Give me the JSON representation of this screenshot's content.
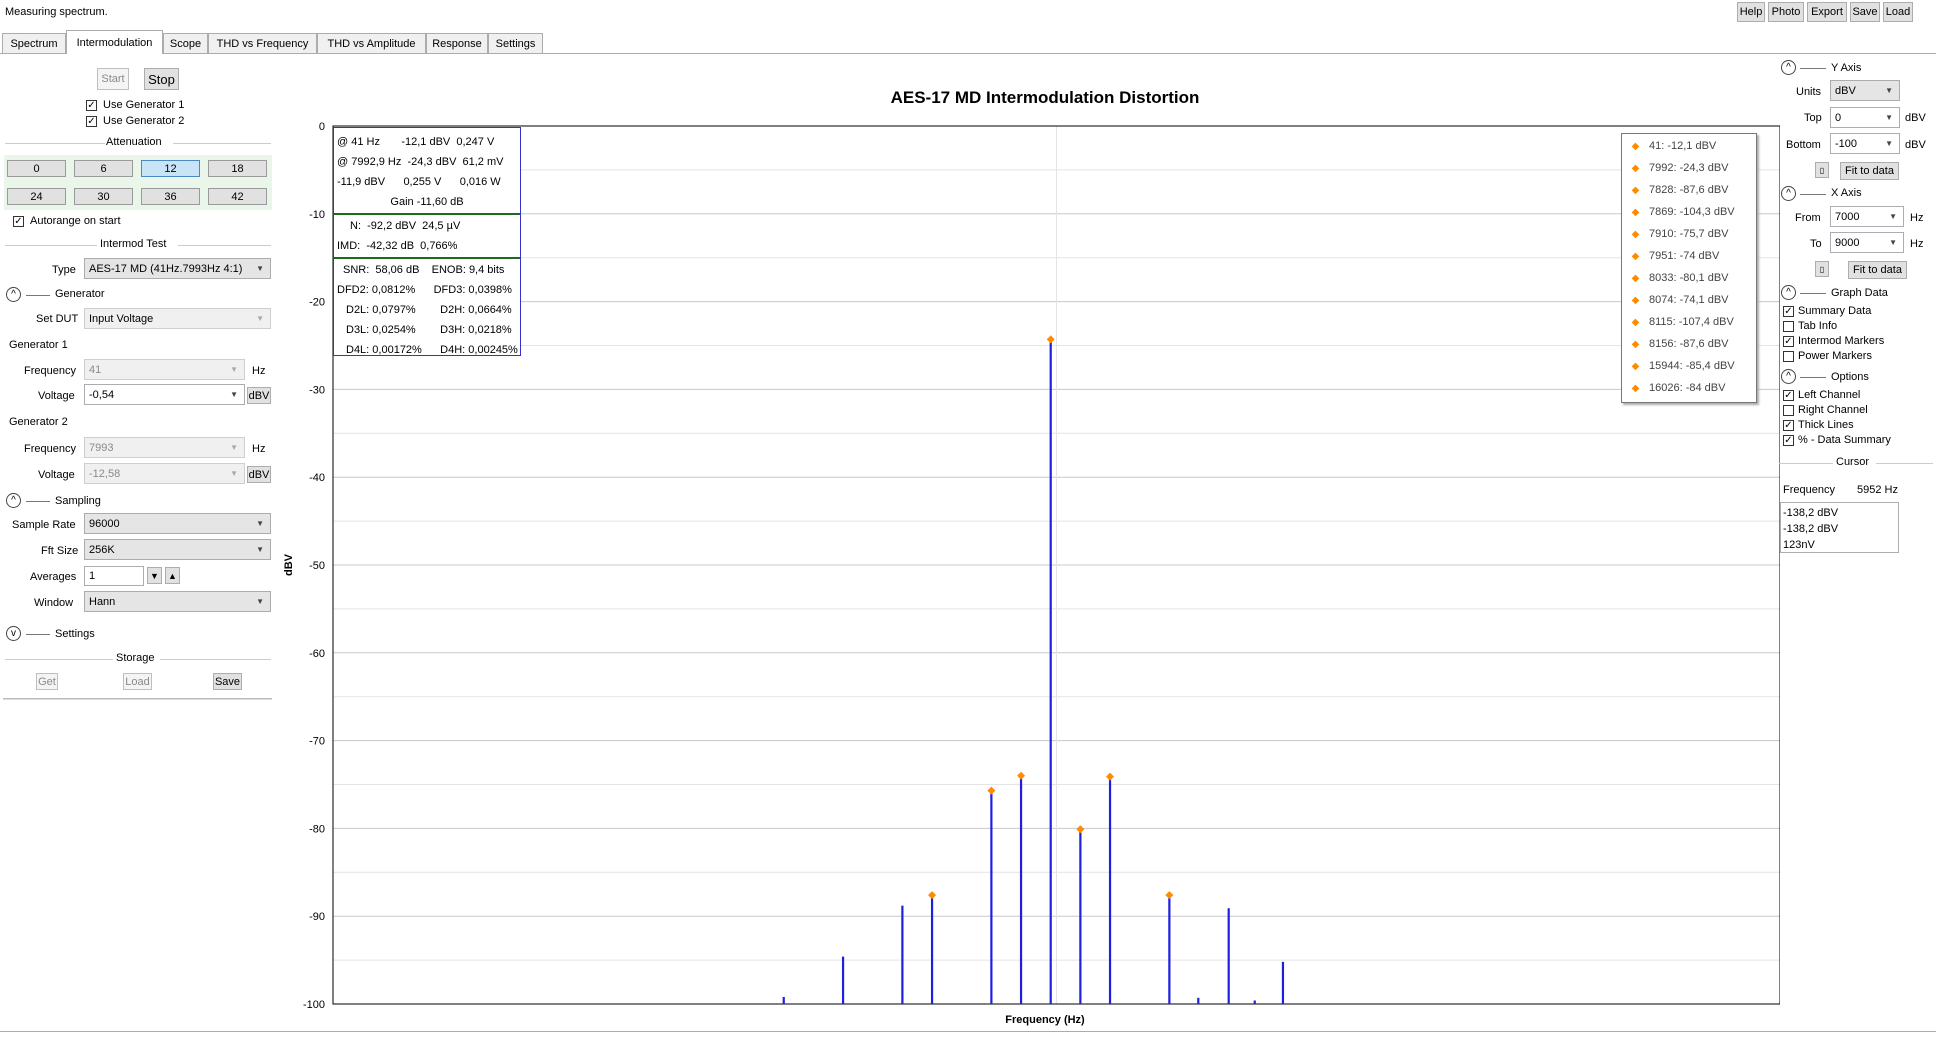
{
  "status": "Measuring spectrum.",
  "top_buttons": [
    "Help",
    "Photo",
    "Export",
    "Save",
    "Load"
  ],
  "tabs": [
    "Spectrum",
    "Intermodulation",
    "Scope",
    "THD vs Frequency",
    "THD vs Amplitude",
    "Response",
    "Settings"
  ],
  "left": {
    "start": "Start",
    "stop": "Stop",
    "use_gen1": "Use Generator 1",
    "use_gen2": "Use Generator 2",
    "attenuation_title": "Attenuation",
    "attenuation": [
      "0",
      "6",
      "12",
      "18",
      "24",
      "30",
      "36",
      "42"
    ],
    "attenuation_selected": "12",
    "autorange": "Autorange on start",
    "intermod_title": "Intermod Test",
    "type_label": "Type",
    "type_value": "AES-17 MD (41Hz.7993Hz 4:1)",
    "generator_title": "Generator",
    "setdut_label": "Set DUT",
    "setdut_value": "Input Voltage",
    "gen1_title": "Generator 1",
    "gen1_freq_label": "Frequency",
    "gen1_freq": "41",
    "hz": "Hz",
    "gen1_volt_label": "Voltage",
    "gen1_volt": "-0,54",
    "dbv": "dBV",
    "gen2_title": "Generator 2",
    "gen2_freq_label": "Frequency",
    "gen2_freq": "7993",
    "gen2_volt_label": "Voltage",
    "gen2_volt": "-12,58",
    "sampling_title": "Sampling",
    "samplerate_label": "Sample Rate",
    "samplerate": "96000",
    "fft_label": "Fft Size",
    "fft": "256K",
    "averages_label": "Averages",
    "averages": "1",
    "window_label": "Window",
    "window": "Hann",
    "settings_title": "Settings",
    "storage_title": "Storage",
    "get": "Get",
    "load": "Load",
    "save": "Save"
  },
  "chart_data": {
    "type": "bar",
    "title": "AES-17 MD  Intermodulation Distortion",
    "xlabel": "Frequency (Hz)",
    "ylabel": "dBV",
    "ylim": [
      -100,
      0
    ],
    "xlim": [
      7000,
      9000
    ],
    "yticks": [
      "0",
      "-10",
      "-20",
      "-30",
      "-40",
      "-50",
      "-60",
      "-70",
      "-80",
      "-90",
      "-100"
    ],
    "x": [
      7623,
      7705,
      7787,
      7828,
      7869,
      7910,
      7951,
      7992,
      8033,
      8074,
      8115,
      8156,
      8196,
      8238,
      8274,
      8313
    ],
    "values": [
      -99.2,
      -94.6,
      -88.8,
      -87.6,
      -104.3,
      -75.7,
      -74.0,
      -24.3,
      -80.1,
      -74.1,
      -107.4,
      -87.6,
      -99.3,
      -89.1,
      -99.6,
      -95.2
    ],
    "markers_x": [
      7828,
      7910,
      7951,
      7992,
      8033,
      8074,
      8156
    ],
    "markers_y": [
      -87.6,
      -75.7,
      -74.0,
      -24.3,
      -80.1,
      -74.1,
      -87.6
    ]
  },
  "info_box": {
    "row1": "@ 41 Hz       -12,1 dBV  0,247 V",
    "row2": "@ 7992,9 Hz  -24,3 dBV  61,2 mV",
    "row3": "-11,9 dBV      0,255 V      0,016 W",
    "row4": "Gain -11,60 dB",
    "row5": "N:  -92,2 dBV  24,5 µV",
    "row6": "IMD:  -42,32 dB  0,766%",
    "row7": "SNR:  58,06 dB    ENOB: 9,4 bits",
    "row8": "DFD2: 0,0812%      DFD3: 0,0398%",
    "row9": "D2L: 0,0797%        D2H: 0,0664%",
    "row10": "D3L: 0,0254%        D3H: 0,0218%",
    "row11": "D4L: 0,00172%      D4H: 0,00245%"
  },
  "legend": [
    "41: -12,1 dBV",
    "7992: -24,3 dBV",
    "7828: -87,6 dBV",
    "7869: -104,3 dBV",
    "7910: -75,7 dBV",
    "7951: -74 dBV",
    "8033: -80,1 dBV",
    "8074: -74,1 dBV",
    "8115: -107,4 dBV",
    "8156: -87,6 dBV",
    "15944: -85,4 dBV",
    "16026: -84 dBV"
  ],
  "right": {
    "yaxis_title": "Y Axis",
    "units_label": "Units",
    "units": "dBV",
    "top_label": "Top",
    "top": "0",
    "bottom_label": "Bottom",
    "bottom": "-100",
    "dbv": "dBV",
    "fit": "Fit to data",
    "xaxis_title": "X Axis",
    "from_label": "From",
    "from": "7000",
    "to_label": "To",
    "to": "9000",
    "hz": "Hz",
    "graphdata_title": "Graph Data",
    "gd1": "Summary Data",
    "gd2": "Tab Info",
    "gd3": "Intermod Markers",
    "gd4": "Power Markers",
    "options_title": "Options",
    "op1": "Left Channel",
    "op2": "Right Channel",
    "op3": "Thick Lines",
    "op4": "% - Data Summary",
    "cursor_title": "Cursor",
    "cursor_freq_label": "Frequency",
    "cursor_freq": "5952 Hz",
    "cursor_v1": "-138,2 dBV",
    "cursor_v2": "-138,2 dBV",
    "cursor_v3": "123nV"
  }
}
